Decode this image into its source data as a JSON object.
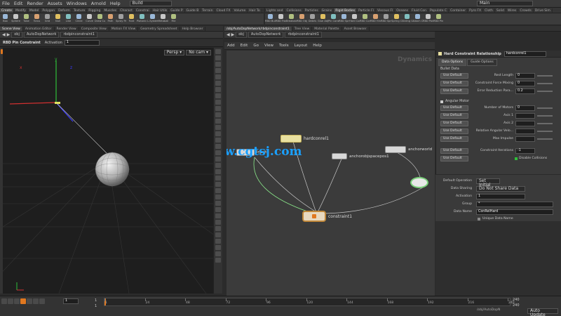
{
  "menubar": {
    "items": [
      "File",
      "Edit",
      "Render",
      "Assets",
      "Windows",
      "Arnold",
      "Help"
    ],
    "desktop_left": "Build",
    "desktop_right": "Main"
  },
  "shelf_tabs_left": [
    "Create",
    "Modify",
    "Model",
    "Polygon",
    "Deform",
    "Texture",
    "Rigging",
    "Muscles",
    "Charact",
    "Constrai",
    "Hair Utils",
    "Guide P",
    "Guide B",
    "Terrain",
    "Cloud FX",
    "Volume",
    "Hair To"
  ],
  "shelf_tabs_right": [
    "Lights and",
    "Collisions",
    "Particles",
    "Grains",
    "Rigid Bodies",
    "Particle Fl",
    "Viscous Fl",
    "Oceans",
    "Fluid Con",
    "Populate C",
    "Container",
    "Pyro FX",
    "Cloth",
    "Solid",
    "Wires",
    "Crowds",
    "Drive Sim"
  ],
  "shelf_tools_left": [
    "Box",
    "Sphere",
    "Tube",
    "Torus",
    "Grid",
    "Null",
    "Line",
    "Circle",
    "Curve",
    "Draw Curve",
    "Path",
    "Spray Paint",
    "Font",
    "Platonic Solids",
    "L-System",
    "Metaball",
    "File"
  ],
  "shelf_tools_right": [
    "RBD Bullet Solver",
    "RBD Fractured Object",
    "Breakable",
    "RBD Objects",
    "Debris",
    "Glue Adjacent",
    "Pin Constraint",
    "RBD Spring Constraint",
    "Hard Constraint",
    "RBD Cone Twist",
    "RBD Hinge",
    "RBD Spring",
    "Spring Constraint",
    "Sliding Constraint",
    "Attach Constraint",
    "RBD Point Constraint",
    "RBD Pin Constraint"
  ],
  "left_pane": {
    "tabs": [
      "Scene View",
      "Animation Editor",
      "Render View",
      "Composite View",
      "Motion FX View",
      "Geometry Spreadsheet",
      "Help Browser"
    ],
    "path": [
      "obj",
      "AutoDopNetwork",
      "rbdpinconstraint1"
    ],
    "state_tool": "RBD Pin Constraint",
    "activation_label": "Activation",
    "activation_value": "1",
    "persp": "Persp ▾",
    "cam": "No cam ▾"
  },
  "right_pane": {
    "tabs": [
      "/obj/AutoDopNetwork/rbdpinconstraint1",
      "Tree View",
      "Material Palette",
      "Asset Browser"
    ],
    "path": [
      "obj",
      "AutoDopNetwork",
      "rbdpinconstraint1"
    ],
    "menu": [
      "Add",
      "Edit",
      "Go",
      "View",
      "Tools",
      "Layout",
      "Help"
    ],
    "context_label": "Dynamics"
  },
  "network": {
    "nodes": [
      {
        "name": "hardconrel1"
      },
      {
        "name": "anchorobjspacepos1"
      },
      {
        "name": "anchorworld"
      },
      {
        "name": "Input"
      },
      {
        "name": "constraint1"
      }
    ]
  },
  "params": {
    "header_type": "Hard Constraint Relationship",
    "header_name": "hardconrel1",
    "tabs": [
      "Data Options",
      "Guide Options"
    ],
    "section": "Bullet Data",
    "use_default": "Use Default",
    "rows": [
      {
        "label": "Rest Length",
        "value": "0"
      },
      {
        "label": "Constraint Force Mixing",
        "value": "0"
      },
      {
        "label": "Error Reduction Para...",
        "value": "0.2"
      }
    ],
    "angular_motor": "Angular Motor",
    "motor_rows": [
      {
        "label": "Number of Motors",
        "value": "0"
      },
      {
        "label": "Axis 1",
        "value": ""
      },
      {
        "label": "Axis 2",
        "value": ""
      },
      {
        "label": "Relative Angular Velo...",
        "value": ""
      },
      {
        "label": "Max Impulse",
        "value": ""
      }
    ],
    "iterations_label": "Constraint Iterations",
    "iterations_value": "-1",
    "disable_collisions": "Disable Collisions",
    "default_operation_label": "Default Operation",
    "default_operation_value": "Set Initial",
    "data_sharing_label": "Data Sharing",
    "data_sharing_value": "Do Not Share Data",
    "activation_label": "Activation",
    "activation_value": "1",
    "group_label": "Group",
    "group_value": "*",
    "data_name_label": "Data Name",
    "data_name_value": "ConRelHard",
    "unique_label": "Unique Data Name"
  },
  "watermark": "www.cgtsj.com",
  "timeline": {
    "current": "1",
    "start": "1",
    "start2": "1",
    "ticks": [
      "1",
      "24",
      "48",
      "72",
      "96",
      "120",
      "144",
      "168",
      "192",
      "216",
      "240"
    ],
    "end": "240",
    "end2": "240",
    "path_label": "/obj/AutoDopN",
    "update_label": "Auto Update"
  },
  "colors": {
    "bg": "#2b2b2b",
    "panel": "#3a3a3a",
    "viewport": "#1e1e1e",
    "network": "#3b3b3b",
    "accent_orange": "#e07820",
    "watermark": "#1aa0ff",
    "node_yellow": "#e8e0a0"
  }
}
